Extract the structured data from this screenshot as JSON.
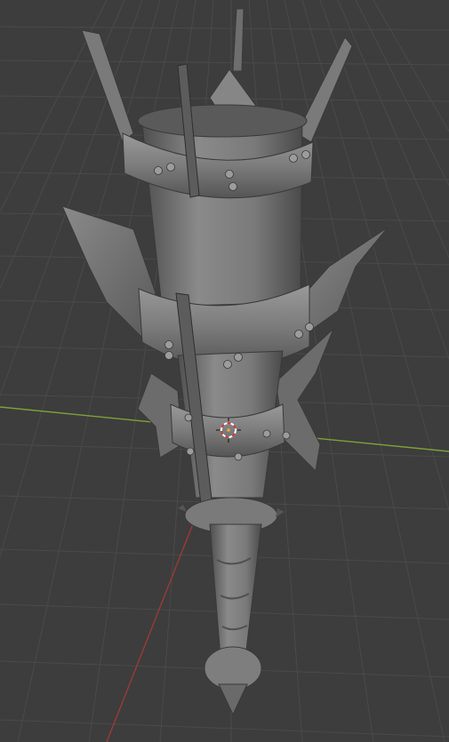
{
  "viewport": {
    "background_color": "#3d3d3d",
    "grid_color": "#4a4a4a",
    "x_axis_color": "#9a3a3a",
    "y_axis_color": "#7aa23a",
    "model_base_color": "#767676",
    "model_shade_color": "#4f4f4f",
    "model_highlight_color": "#9a9a9a"
  },
  "objects": {
    "model": {
      "icon": "mace-mesh"
    },
    "cursor_3d": {
      "icon": "3d-cursor-icon",
      "ring_color_a": "#d23b3b",
      "ring_color_b": "#ffffff"
    }
  }
}
